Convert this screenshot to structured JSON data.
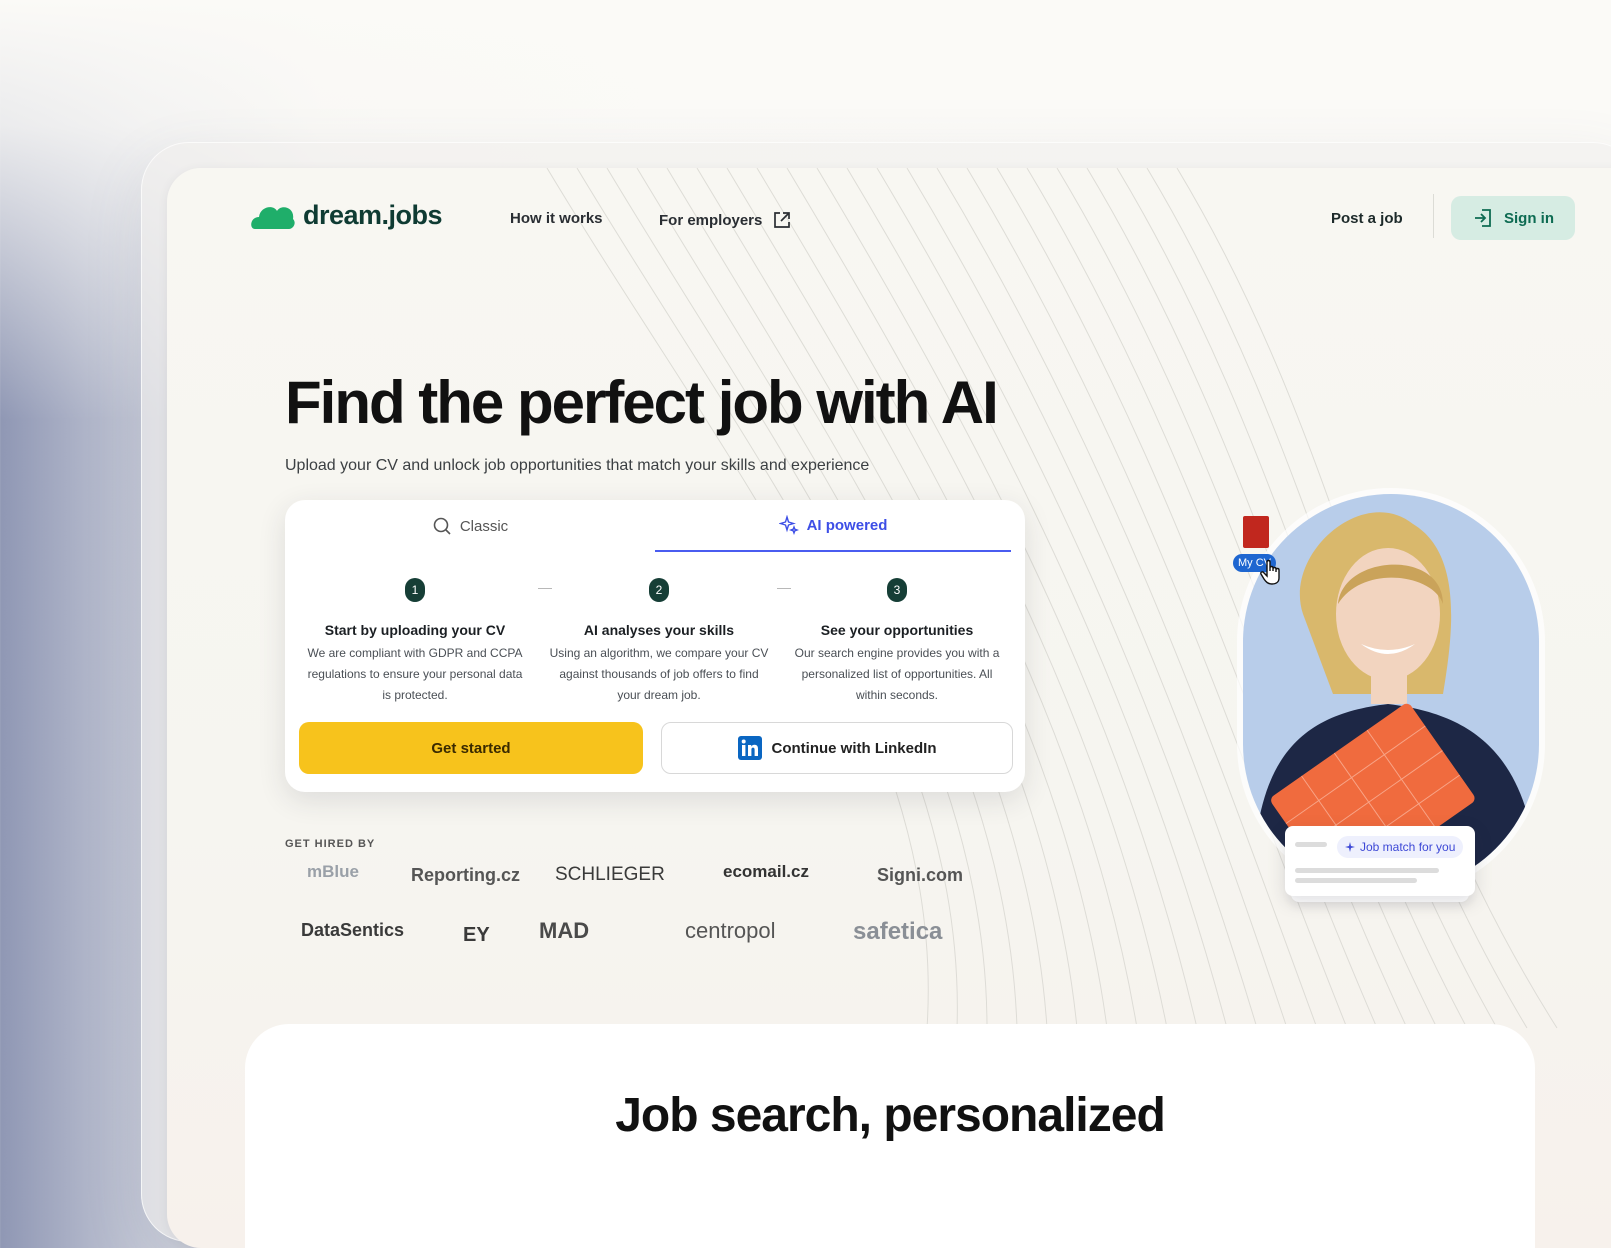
{
  "brand": {
    "name": "dream.jobs",
    "color": "#1e9e63"
  },
  "nav": {
    "how_it_works": "How it works",
    "for_employers": "For employers",
    "post_job": "Post a job",
    "sign_in": "Sign in"
  },
  "hero": {
    "title": "Find the perfect job with AI",
    "subtitle": "Upload your CV and unlock job opportunities that match your skills and experience"
  },
  "search_card": {
    "tabs": [
      {
        "label": "Classic",
        "icon": "search-icon",
        "active": false
      },
      {
        "label": "AI powered",
        "icon": "sparkle-icon",
        "active": true
      }
    ],
    "steps": [
      {
        "num": "1",
        "title": "Start by uploading your CV",
        "desc": "We are compliant with GDPR and CCPA regulations to ensure your personal data is protected."
      },
      {
        "num": "2",
        "title": "AI analyses your skills",
        "desc": "Using an algorithm, we compare your CV against thousands of job offers to find your dream job."
      },
      {
        "num": "3",
        "title": "See your opportunities",
        "desc": "Our search engine provides you with a personalized list of opportunities. All within seconds."
      }
    ],
    "get_started": "Get started",
    "linkedin": "Continue with LinkedIn"
  },
  "hired": {
    "label": "GET HIRED BY",
    "logos": [
      "mBlue",
      "Reporting.cz",
      "SCHLIEGER",
      "ecomail.cz",
      "Signi.com",
      "DataSentics",
      "EY",
      "MAD",
      "centropol",
      "safetica"
    ]
  },
  "illustration": {
    "cv_label": "My CV",
    "match_label": "Job match for you"
  },
  "section2": {
    "title": "Job search, personalized"
  },
  "colors": {
    "accent": "#4a5cf0",
    "cta": "#f7c31c",
    "signin_bg": "#d6ece3",
    "dark_green": "#163e36"
  }
}
